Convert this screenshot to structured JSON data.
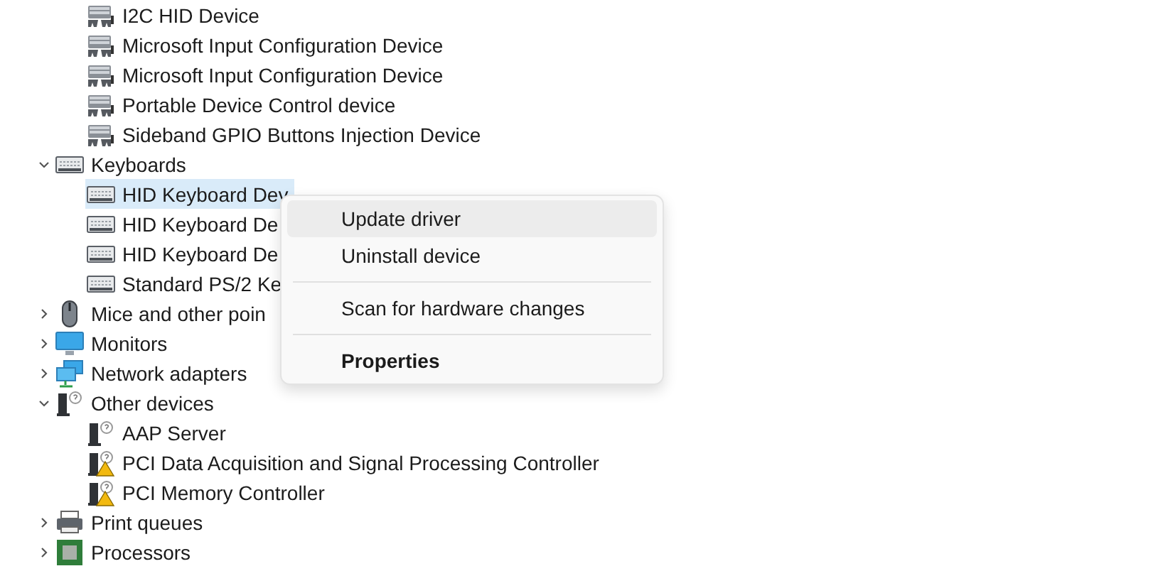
{
  "tree": [
    {
      "label": "I2C HID Device",
      "kind": "hid",
      "selected": false
    },
    {
      "label": "Microsoft Input Configuration Device",
      "kind": "hid",
      "selected": false
    },
    {
      "label": "Microsoft Input Configuration Device",
      "kind": "hid",
      "selected": false
    },
    {
      "label": "Portable Device Control device",
      "kind": "hid",
      "selected": false
    },
    {
      "label": "Sideband GPIO Buttons Injection Device",
      "kind": "hid",
      "selected": false
    },
    {
      "label": "Keyboards",
      "kind": "keyboard",
      "expanded": true,
      "selected": false,
      "children": [
        {
          "label": "HID Keyboard Dev",
          "kind": "keyboard",
          "selected": true
        },
        {
          "label": "HID Keyboard De",
          "kind": "keyboard",
          "selected": false
        },
        {
          "label": "HID Keyboard De",
          "kind": "keyboard",
          "selected": false
        },
        {
          "label": "Standard PS/2 Ke",
          "kind": "keyboard",
          "selected": false
        }
      ]
    },
    {
      "label": "Mice and other poin",
      "kind": "mouse",
      "expanded": false,
      "selected": false
    },
    {
      "label": "Monitors",
      "kind": "monitor",
      "expanded": false,
      "selected": false
    },
    {
      "label": "Network adapters",
      "kind": "network",
      "expanded": false,
      "selected": false
    },
    {
      "label": "Other devices",
      "kind": "unknown",
      "expanded": true,
      "selected": false,
      "children": [
        {
          "label": "AAP Server",
          "kind": "unknown",
          "selected": false
        },
        {
          "label": "PCI Data Acquisition and Signal Processing Controller",
          "kind": "warning",
          "selected": false
        },
        {
          "label": "PCI Memory Controller",
          "kind": "warning",
          "selected": false
        }
      ]
    },
    {
      "label": "Print queues",
      "kind": "printer",
      "expanded": false,
      "selected": false
    },
    {
      "label": "Processors",
      "kind": "cpu",
      "expanded": false,
      "selected": false
    }
  ],
  "context_menu": [
    {
      "label": "Update driver",
      "selected": true,
      "default": false,
      "separator_after": false
    },
    {
      "label": "Uninstall device",
      "selected": false,
      "default": false,
      "separator_after": true
    },
    {
      "label": "Scan for hardware changes",
      "selected": false,
      "default": false,
      "separator_after": true
    },
    {
      "label": "Properties",
      "selected": false,
      "default": true,
      "separator_after": false
    }
  ]
}
